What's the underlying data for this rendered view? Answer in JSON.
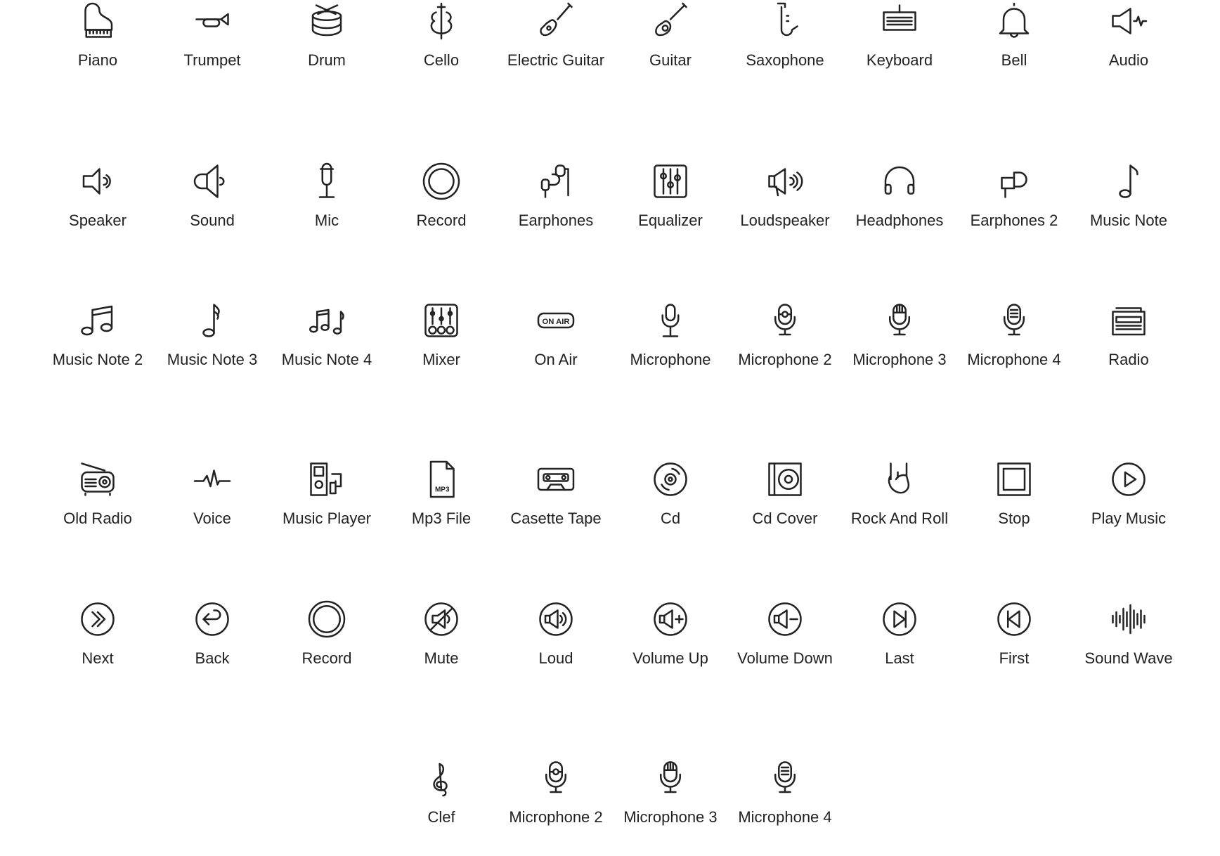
{
  "colors": {
    "icon_stroke": "#222222",
    "label": "#222222",
    "background": "#ffffff"
  },
  "rows": [
    [
      {
        "label": "Piano",
        "icon": "piano-icon"
      },
      {
        "label": "Trumpet",
        "icon": "trumpet-icon"
      },
      {
        "label": "Drum",
        "icon": "drum-icon"
      },
      {
        "label": "Cello",
        "icon": "cello-icon"
      },
      {
        "label": "Electric Guitar",
        "icon": "electric-guitar-icon"
      },
      {
        "label": "Guitar",
        "icon": "guitar-icon"
      },
      {
        "label": "Saxophone",
        "icon": "saxophone-icon"
      },
      {
        "label": "Keyboard",
        "icon": "keyboard-icon"
      },
      {
        "label": "Bell",
        "icon": "bell-icon"
      },
      {
        "label": "Audio",
        "icon": "audio-icon"
      }
    ],
    [
      {
        "label": "Speaker",
        "icon": "speaker-icon"
      },
      {
        "label": "Sound",
        "icon": "sound-icon"
      },
      {
        "label": "Mic",
        "icon": "mic-icon"
      },
      {
        "label": "Record",
        "icon": "record-icon"
      },
      {
        "label": "Earphones",
        "icon": "earphones-icon"
      },
      {
        "label": "Equalizer",
        "icon": "equalizer-icon"
      },
      {
        "label": "Loudspeaker",
        "icon": "loudspeaker-icon"
      },
      {
        "label": "Headphones",
        "icon": "headphones-icon"
      },
      {
        "label": "Earphones 2",
        "icon": "earphones-2-icon"
      },
      {
        "label": "Music Note",
        "icon": "music-note-icon"
      }
    ],
    [
      {
        "label": "Music Note 2",
        "icon": "music-note-2-icon"
      },
      {
        "label": "Music Note 3",
        "icon": "music-note-3-icon"
      },
      {
        "label": "Music Note 4",
        "icon": "music-note-4-icon"
      },
      {
        "label": "Mixer",
        "icon": "mixer-icon"
      },
      {
        "label": "On Air",
        "icon": "on-air-icon",
        "icon_text": "ON AIR"
      },
      {
        "label": "Microphone",
        "icon": "microphone-icon"
      },
      {
        "label": "Microphone 2",
        "icon": "microphone-2-icon"
      },
      {
        "label": "Microphone 3",
        "icon": "microphone-3-icon"
      },
      {
        "label": "Microphone 4",
        "icon": "microphone-4-icon"
      },
      {
        "label": "Radio",
        "icon": "radio-icon"
      }
    ],
    [
      {
        "label": "Old Radio",
        "icon": "old-radio-icon"
      },
      {
        "label": "Voice",
        "icon": "voice-icon"
      },
      {
        "label": "Music Player",
        "icon": "music-player-icon"
      },
      {
        "label": "Mp3 File",
        "icon": "mp3-file-icon",
        "icon_text": "MP3"
      },
      {
        "label": "Casette Tape",
        "icon": "casette-tape-icon"
      },
      {
        "label": "Cd",
        "icon": "cd-icon"
      },
      {
        "label": "Cd Cover",
        "icon": "cd-cover-icon"
      },
      {
        "label": "Rock And Roll",
        "icon": "rock-and-roll-icon"
      },
      {
        "label": "Stop",
        "icon": "stop-icon"
      },
      {
        "label": "Play Music",
        "icon": "play-music-icon"
      }
    ],
    [
      {
        "label": "Next",
        "icon": "next-icon"
      },
      {
        "label": "Back",
        "icon": "back-icon"
      },
      {
        "label": "Record",
        "icon": "record-circle-icon"
      },
      {
        "label": "Mute",
        "icon": "mute-icon"
      },
      {
        "label": "Loud",
        "icon": "loud-icon"
      },
      {
        "label": "Volume Up",
        "icon": "volume-up-icon"
      },
      {
        "label": "Volume Down",
        "icon": "volume-down-icon"
      },
      {
        "label": "Last",
        "icon": "last-icon"
      },
      {
        "label": "First",
        "icon": "first-icon"
      },
      {
        "label": "Sound Wave",
        "icon": "sound-wave-icon"
      }
    ],
    [
      {
        "label": "Clef",
        "icon": "clef-icon"
      },
      {
        "label": "Microphone 2",
        "icon": "microphone-2-icon"
      },
      {
        "label": "Microphone 3",
        "icon": "microphone-3-icon"
      },
      {
        "label": "Microphone 4",
        "icon": "microphone-4-icon"
      }
    ]
  ]
}
